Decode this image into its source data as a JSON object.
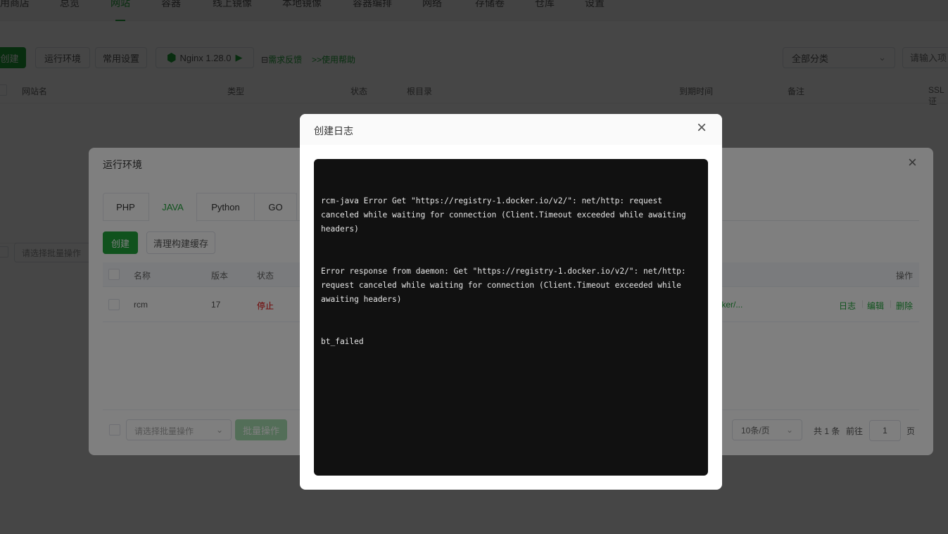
{
  "nav": {
    "items": [
      "用商店",
      "总览",
      "网站",
      "容器",
      "线上镜像",
      "本地镜像",
      "容器编排",
      "网络",
      "存储卷",
      "仓库",
      "设置"
    ],
    "active": 2
  },
  "toolbar": {
    "create": "创建",
    "runtime": "运行环境",
    "common_settings": "常用设置",
    "nginx": "Nginx 1.28.0",
    "feedback": "需求反馈",
    "help": ">>使用帮助",
    "category": "全部分类",
    "search_placeholder": "请输入项目"
  },
  "site_table": {
    "headers": [
      "网站名",
      "类型",
      "状态",
      "根目录",
      "到期时间",
      "备注",
      "SSL证"
    ]
  },
  "bg_batch_placeholder": "请选择批量操作",
  "runtime_dialog": {
    "title": "运行环境",
    "tabs": [
      "PHP",
      "JAVA",
      "Python",
      "GO"
    ],
    "active_tab": 1,
    "create": "创建",
    "clear_cache": "清理构建缓存",
    "headers": {
      "name": "名称",
      "version": "版本",
      "status": "状态",
      "actions": "操作"
    },
    "rows": [
      {
        "name": "rcm",
        "version": "17",
        "status": "停止",
        "path": "docker/...",
        "actions": [
          "日志",
          "编辑",
          "删除"
        ]
      }
    ],
    "batch_placeholder": "请选择批量操作",
    "batch_button": "批量操作",
    "page_size": "10条/页",
    "total": "共 1 条",
    "goto": "前往",
    "page": "1",
    "page_suffix": "页"
  },
  "log_dialog": {
    "title": "创建日志",
    "lines": [
      "rcm-java Error Get \"https://registry-1.docker.io/v2/\": net/http: request canceled while waiting for connection (Client.Timeout exceeded while awaiting headers)",
      "Error response from daemon: Get \"https://registry-1.docker.io/v2/\": net/http: request canceled while waiting for connection (Client.Timeout exceeded while awaiting headers)",
      "bt_failed"
    ]
  },
  "colors": {
    "accent": "#20a53a",
    "danger": "#e00000",
    "log_bg": "#111111"
  }
}
